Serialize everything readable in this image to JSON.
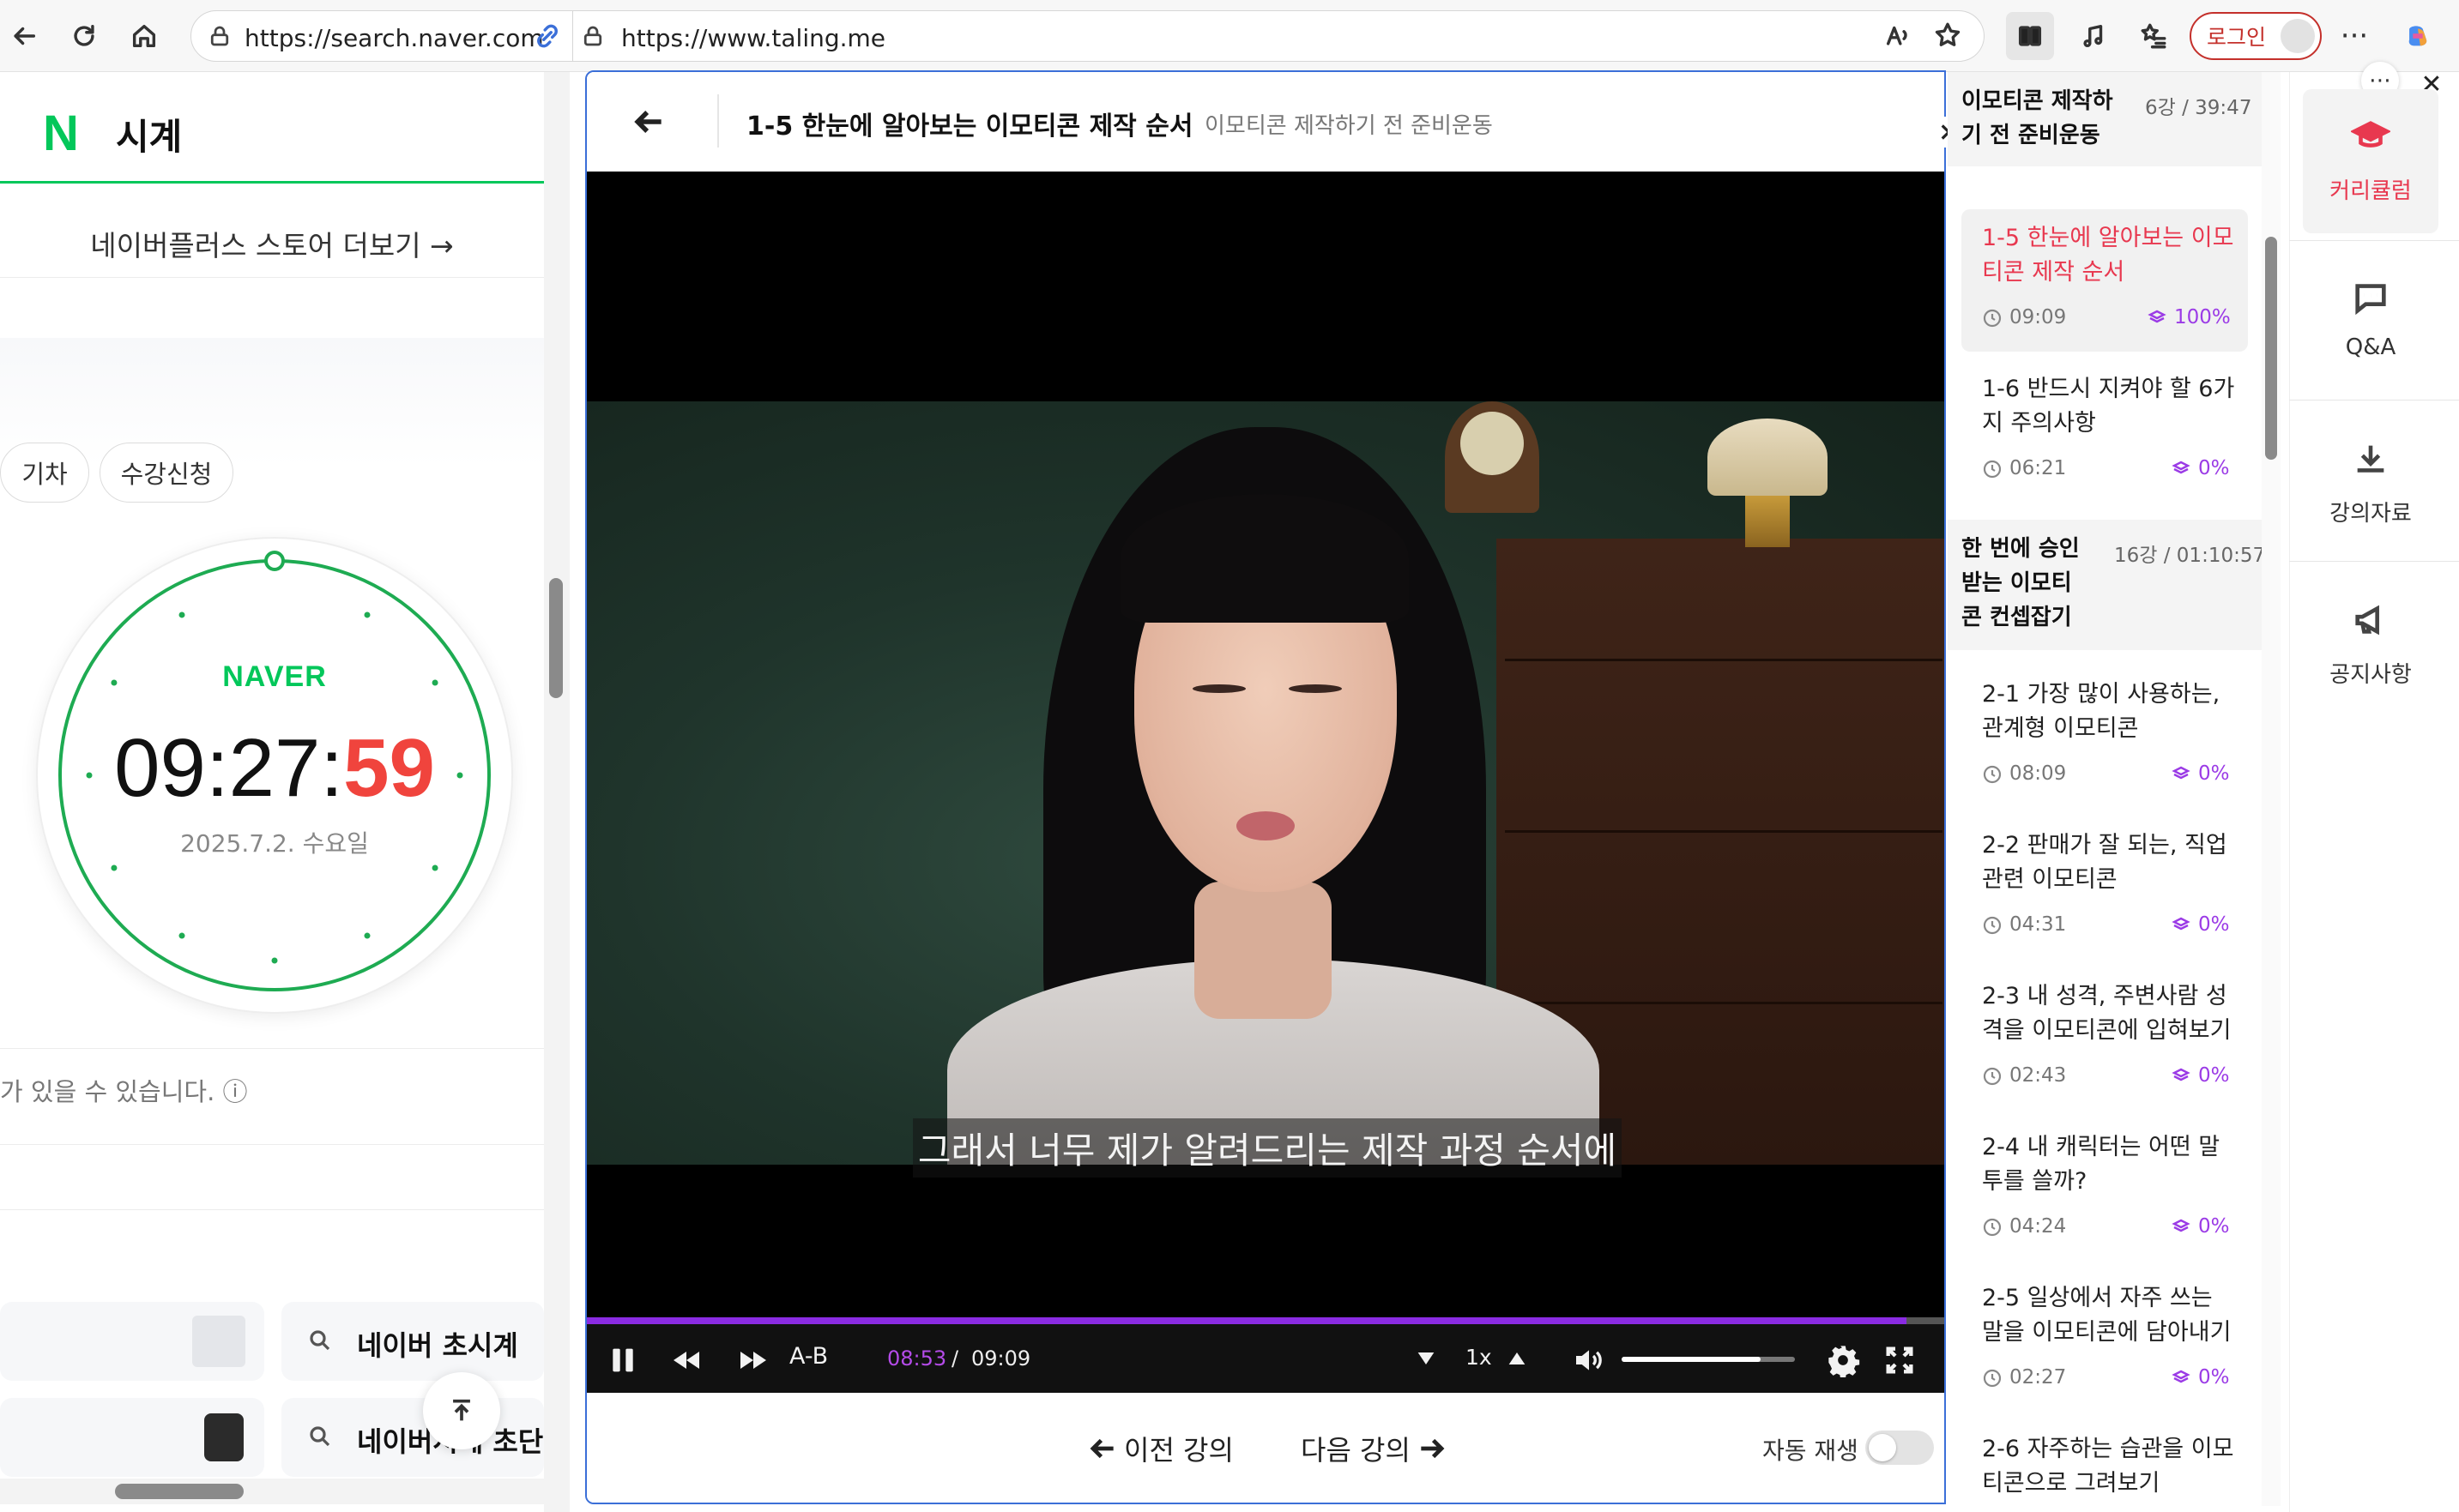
{
  "browser": {
    "url_left": "https://search.naver.com",
    "url_right": "https://www.taling.me",
    "login_label": "로그인",
    "more_label": "···"
  },
  "naver": {
    "logo": "N",
    "title": "시계",
    "store_more": "네이버플러스 스토어 더보기 →",
    "chips": [
      "기차",
      "수강신청"
    ],
    "clock": {
      "brand": "NAVER",
      "time_hm": "09:27:",
      "time_sec": "59",
      "date": "2025.7.2. 수요일"
    },
    "notice": "가 있을 수 있습니다. ⓘ",
    "related": [
      "네이버 초시계",
      "네이버시계 초단"
    ]
  },
  "lecture": {
    "title": "1-5 한눈에 알아보는 이모티콘 제작 순서",
    "chapter": "이모티콘 제작하기 전 준비운동",
    "subtitle": "그래서 너무 제가 알려드리는 제작 과정 순서에",
    "player": {
      "ab_label": "A-B",
      "current_time": "08:53",
      "separator": "/",
      "total_time": "09:09",
      "speed": "1x",
      "progress": 0.97,
      "volume": 0.8
    },
    "prev_label": "이전 강의",
    "next_label": "다음 강의",
    "autoplay_label": "자동 재생",
    "autoplay_on": false
  },
  "curriculum": {
    "sections": [
      {
        "title": "이모티콘 제작하기 전 준비운동",
        "meta": "6강 / 39:47",
        "lessons": [
          {
            "title": "1-5 한눈에 알아보는 이모티콘 제작 순서",
            "duration": "09:09",
            "progress": "100%",
            "active": true
          },
          {
            "title": "1-6 반드시 지켜야 할 6가지 주의사항",
            "duration": "06:21",
            "progress": "0%",
            "active": false
          }
        ]
      },
      {
        "title": "한 번에 승인 받는 이모티콘 컨셉잡기",
        "meta": "16강 / 01:10:57",
        "lessons": [
          {
            "title": "2-1 가장 많이 사용하는, 관계형 이모티콘",
            "duration": "08:09",
            "progress": "0%",
            "active": false
          },
          {
            "title": "2-2 판매가 잘 되는, 직업 관련 이모티콘",
            "duration": "04:31",
            "progress": "0%",
            "active": false
          },
          {
            "title": "2-3 내 성격, 주변사람 성격을 이모티콘에 입혀보기",
            "duration": "02:43",
            "progress": "0%",
            "active": false
          },
          {
            "title": "2-4 내 캐릭터는 어떤 말투를 쓸까?",
            "duration": "04:24",
            "progress": "0%",
            "active": false
          },
          {
            "title": "2-5 일상에서 자주 쓰는 말을 이모티콘에 담아내기",
            "duration": "02:27",
            "progress": "0%",
            "active": false
          },
          {
            "title": "2-6 자주하는 습관을 이모티콘으로 그려보기",
            "duration": "",
            "progress": "",
            "active": false
          }
        ]
      }
    ]
  },
  "side_tabs": [
    {
      "label": "커리큘럼",
      "icon": "graduation-cap-icon",
      "active": true
    },
    {
      "label": "Q&A",
      "icon": "chat-bubble-icon",
      "active": false
    },
    {
      "label": "강의자료",
      "icon": "download-icon",
      "active": false
    },
    {
      "label": "공지사항",
      "icon": "megaphone-icon",
      "active": false
    }
  ],
  "colors": {
    "naver_green": "#03c75a",
    "accent_red": "#e8384f",
    "progress_purple": "#9b3be6",
    "focus_blue": "#3b6fd8"
  }
}
